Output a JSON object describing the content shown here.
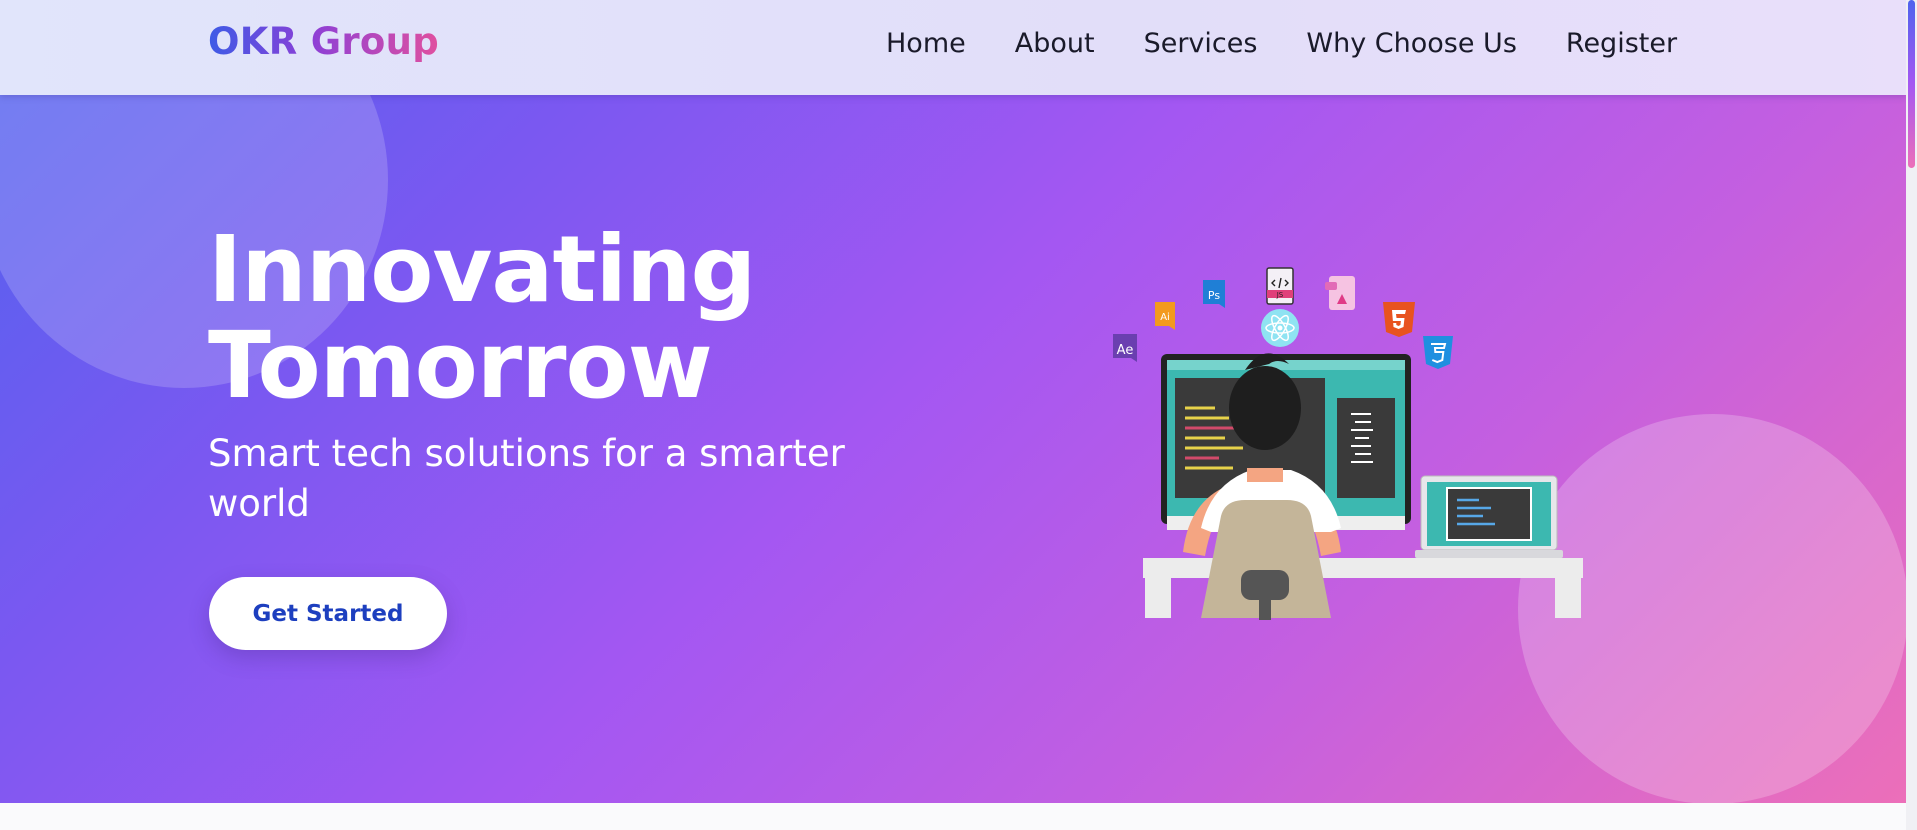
{
  "brand": {
    "name": "OKR Group"
  },
  "nav": {
    "items": [
      {
        "label": "Home"
      },
      {
        "label": "About"
      },
      {
        "label": "Services"
      },
      {
        "label": "Why Choose Us"
      },
      {
        "label": "Register"
      }
    ]
  },
  "hero": {
    "title_line1": "Innovating",
    "title_line2": "Tomorrow",
    "subtitle": "Smart tech solutions for a smarter world",
    "cta_label": "Get Started"
  },
  "illustration": {
    "tech_icons": [
      "Ae",
      "Ai",
      "Ps",
      "JS",
      "XD",
      "HTML5",
      "CSS3",
      "React"
    ],
    "icon_texts": {
      "ae": "Ae",
      "ai": "Ai",
      "ps": "Ps",
      "js": "JS"
    }
  },
  "colors": {
    "gradient_start": "#4f63ee",
    "gradient_mid": "#a457f2",
    "gradient_end": "#ec6fb9",
    "cta_text": "#1d3fbf"
  }
}
